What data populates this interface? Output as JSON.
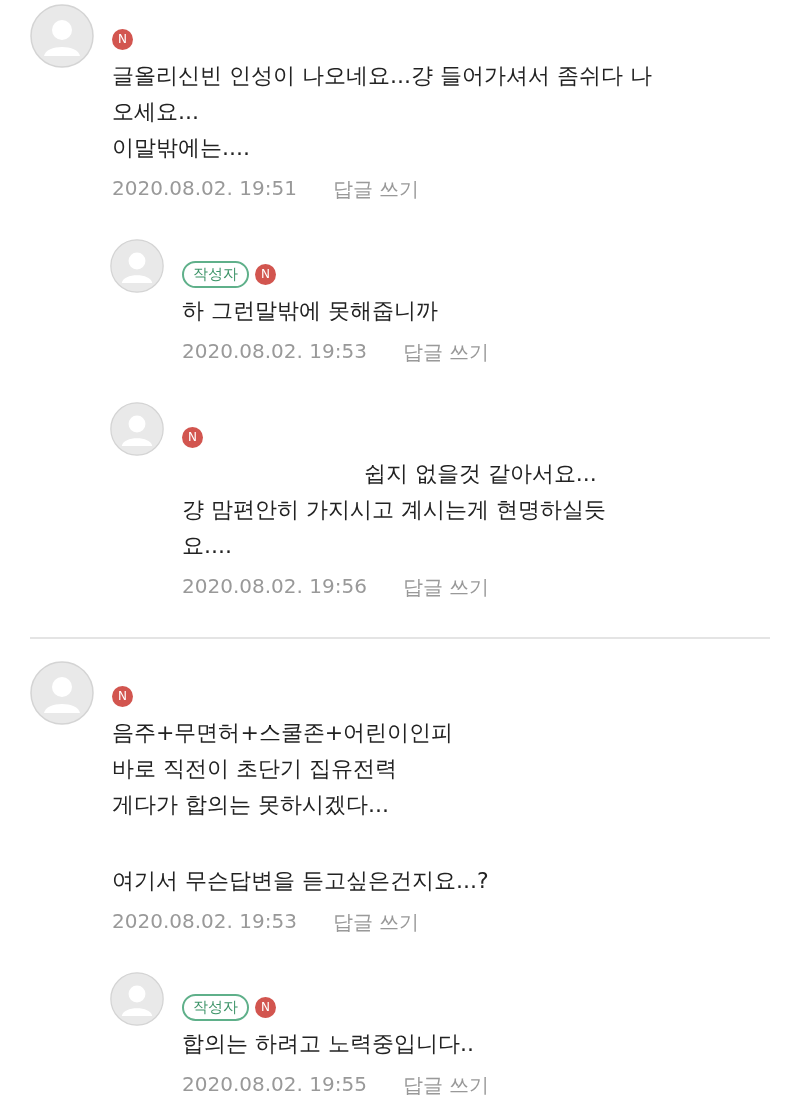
{
  "threads": [
    {
      "comment": {
        "level_badge": "N",
        "paragraphs": [
          [
            "글올리신빈 인성이 나오네요...걍 들어가셔서 좀쉬다 나",
            "오세요...",
            "이말밖에는...."
          ]
        ],
        "time": "2020.08.02. 19:51",
        "reply_link": "답글 쓰기"
      },
      "replies": [
        {
          "author_tag": "작성자",
          "level_badge": "N",
          "paragraphs": [
            [
              "하 그런말밖에 못해줍니까"
            ]
          ],
          "time": "2020.08.02. 19:53",
          "reply_link": "답글 쓰기"
        },
        {
          "level_badge": "N",
          "paragraphs": [
            [
              "                          쉽지 없을것 같아서요...",
              "걍 맘편안히 가지시고 계시는게 현명하실듯",
              "요...."
            ]
          ],
          "time": "2020.08.02. 19:56",
          "reply_link": "답글 쓰기"
        }
      ]
    },
    {
      "comment": {
        "level_badge": "N",
        "paragraphs": [
          [
            "음주+무면허+스쿨존+어린이인피",
            "바로 직전이 초단기 집유전력",
            "게다가 합의는 못하시겠다..."
          ],
          [
            "여기서 무슨답변을 듣고싶은건지요...?"
          ]
        ],
        "time": "2020.08.02. 19:53",
        "reply_link": "답글 쓰기"
      },
      "replies": [
        {
          "author_tag": "작성자",
          "level_badge": "N",
          "paragraphs": [
            [
              "합의는 하려고 노력중입니다.."
            ]
          ],
          "time": "2020.08.02. 19:55",
          "reply_link": "답글 쓰기"
        }
      ]
    }
  ]
}
